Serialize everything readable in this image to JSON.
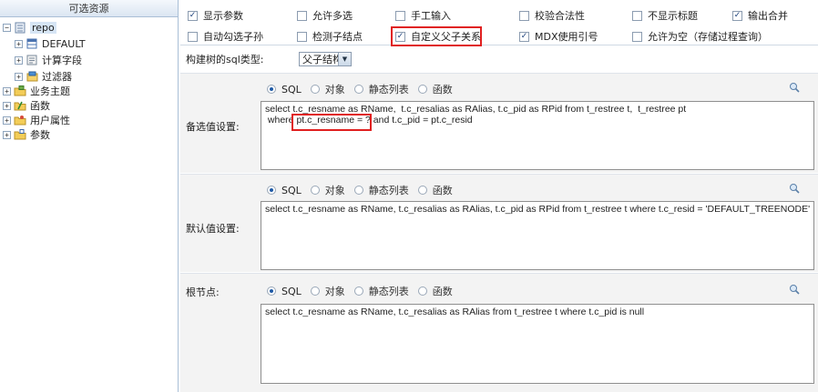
{
  "left_panel": {
    "title": "可选资源",
    "tree": [
      {
        "label": "repo",
        "level": 0,
        "expander": "-",
        "icon": "database-icon",
        "selected": true
      },
      {
        "label": "DEFAULT",
        "level": 1,
        "expander": "+",
        "icon": "table-icon"
      },
      {
        "label": "计算字段",
        "level": 1,
        "expander": "+",
        "icon": "calc-field-icon"
      },
      {
        "label": "过滤器",
        "level": 1,
        "expander": "+",
        "icon": "filter-icon"
      },
      {
        "label": "业务主题",
        "level": 0,
        "expander": "+",
        "icon": "folder-icon"
      },
      {
        "label": "函数",
        "level": 0,
        "expander": "+",
        "icon": "function-icon"
      },
      {
        "label": "用户属性",
        "level": 0,
        "expander": "+",
        "icon": "user-attr-folder-icon"
      },
      {
        "label": "参数",
        "level": 0,
        "expander": "+",
        "icon": "param-folder-icon"
      }
    ]
  },
  "options": {
    "row1": [
      {
        "label": "显示参数",
        "checked": true
      },
      {
        "label": "允许多选",
        "checked": false
      },
      {
        "label": "手工输入",
        "checked": false
      },
      {
        "label": "校验合法性",
        "checked": false
      },
      {
        "label": "不显示标题",
        "checked": false
      },
      {
        "label": "输出合并",
        "checked": true
      }
    ],
    "row2": [
      {
        "label": "自动勾选子孙",
        "checked": false
      },
      {
        "label": "检测子结点",
        "checked": false
      },
      {
        "label": "自定义父子关系",
        "checked": true
      },
      {
        "label": "MDX使用引号",
        "checked": true
      },
      {
        "label": "允许为空（存储过程查询）",
        "checked": false
      }
    ]
  },
  "sql_type": {
    "label": "构建树的sql类型:",
    "value": "父子结构"
  },
  "radio_labels": [
    "SQL",
    "对象",
    "静态列表",
    "函数"
  ],
  "sections": {
    "candidate": {
      "label": "备选值设置:",
      "selected_radio": "SQL",
      "sql_line1": "select t.c_resname as RName,  t.c_resalias as RAlias, t.c_pid as RPid from t_restree t,  t_restree pt",
      "sql_line2_prefix": " where ",
      "sql_line2_highlight": "pt.c_resname = ?",
      "sql_line2_suffix": " and t.c_pid = pt.c_resid"
    },
    "default": {
      "label": "默认值设置:",
      "selected_radio": "SQL",
      "sql": "select t.c_resname as RName, t.c_resalias as RAlias, t.c_pid as RPid from t_restree t where t.c_resid = 'DEFAULT_TREENODE'"
    },
    "root": {
      "label": "根节点:",
      "selected_radio": "SQL",
      "sql": "select t.c_resname as RName, t.c_resalias as RAlias from t_restree t where t.c_pid is null"
    }
  },
  "colors": {
    "highlight_box": "#e02020",
    "radio_selected": "#1f5aa6",
    "panel_border": "#a9bfd6"
  }
}
